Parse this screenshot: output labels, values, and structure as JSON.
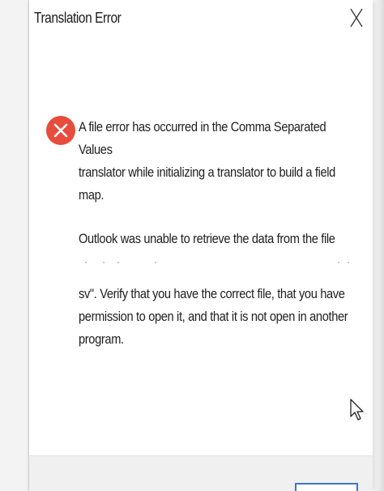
{
  "window": {
    "title": "Translation Error",
    "close_icon": "close-icon"
  },
  "error": {
    "icon": "error-x-icon",
    "icon_color": "#e74c3c",
    "paragraph1": "A file error has occurred in the Comma Separated Values\ntranslator while initializing a translator to build a field map.",
    "paragraph2": "Outlook was unable to retrieve the data from the file",
    "paragraph3": "sv\". Verify that you have the correct file, that you have\npermission to open it, and that it is not open in another\nprogram."
  },
  "colors": {
    "text": "#1e1e1e",
    "button_border": "#3c78c8",
    "footer_bg": "#f0f0f0"
  }
}
